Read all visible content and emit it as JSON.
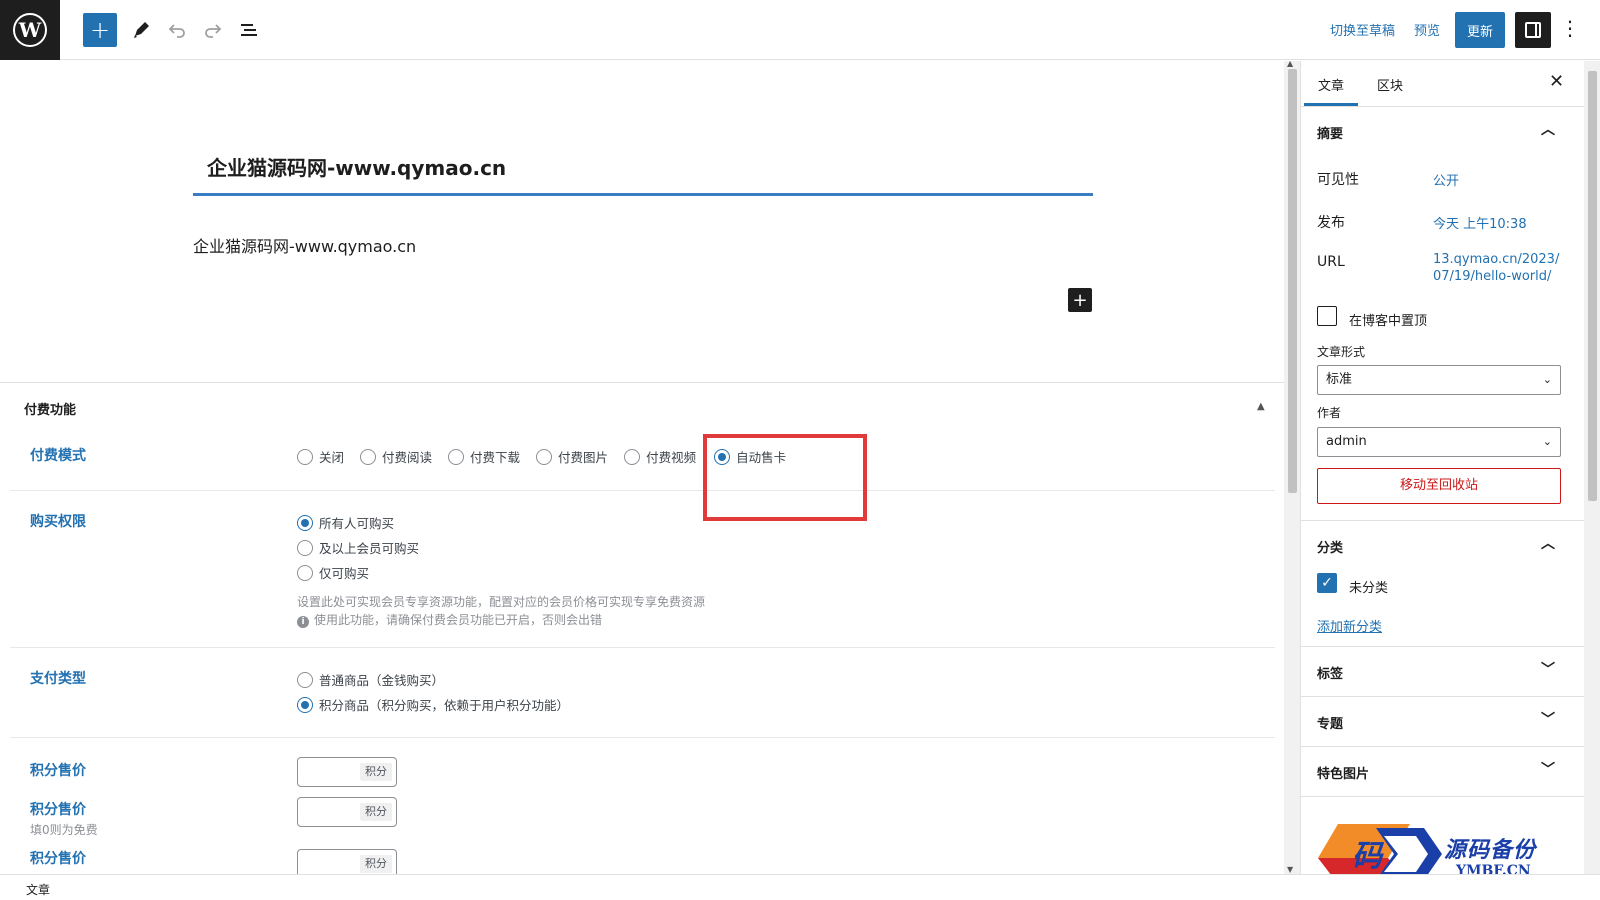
{
  "toolbar": {
    "add_icon": "plus-icon",
    "tools_icon": "pencil-icon",
    "undo_icon": "undo-icon",
    "redo_icon": "redo-icon",
    "outline_icon": "list-view-icon",
    "switch_draft": "切换至草稿",
    "preview": "预览",
    "update": "更新",
    "settings_icon": "sidebar-toggle-icon",
    "more_icon": "more-vertical-icon"
  },
  "post": {
    "title": "企业猫源码网-www.qymao.cn",
    "paragraph": "企业猫源码网-www.qymao.cn"
  },
  "metabox": {
    "title": "付费功能",
    "pay_mode": {
      "label": "付费模式",
      "options": [
        "关闭",
        "付费阅读",
        "付费下载",
        "付费图片",
        "付费视频",
        "自动售卡"
      ],
      "selected": "自动售卡"
    },
    "purchase_permission": {
      "label": "购买权限",
      "options": [
        "所有人可购买",
        "及以上会员可购买",
        "仅可购买"
      ],
      "selected": "所有人可购买",
      "hint1": "设置此处可实现会员专享资源功能，配置对应的会员价格可实现专享免费资源",
      "hint2": "使用此功能，请确保付费会员功能已开启，否则会出错"
    },
    "payment_type": {
      "label": "支付类型",
      "options": [
        "普通商品（金钱购买）",
        "积分商品（积分购买，依赖于用户积分功能）"
      ],
      "selected": "积分商品（积分购买，依赖于用户积分功能）"
    },
    "points_price_1": {
      "label": "积分售价",
      "unit": "积分"
    },
    "points_price_2": {
      "label": "积分售价",
      "sublabel": "填0则为免费",
      "unit": "积分"
    },
    "points_price_3": {
      "label": "积分售价",
      "unit": "积分"
    }
  },
  "sidebar": {
    "tabs": [
      "文章",
      "区块"
    ],
    "active_tab": "文章",
    "summary": {
      "title": "摘要",
      "visibility_label": "可见性",
      "visibility_value": "公开",
      "publish_label": "发布",
      "publish_value": "今天 上午10:38",
      "url_label": "URL",
      "url_line1": "13.qymao.cn/2023/",
      "url_line2": "07/19/hello-world/",
      "sticky_label": "在博客中置顶",
      "format_label": "文章形式",
      "format_value": "标准",
      "author_label": "作者",
      "author_value": "admin",
      "trash": "移动至回收站"
    },
    "categories": {
      "title": "分类",
      "item": "未分类",
      "add_new": "添加新分类"
    },
    "tags": {
      "title": "标签"
    },
    "topics": {
      "title": "专题"
    },
    "featured_image": {
      "title": "特色图片"
    }
  },
  "watermark": {
    "glyph": "码",
    "text": "源码备份",
    "sub": "YMBF.CN"
  },
  "footer": {
    "breadcrumb": "文章"
  },
  "colors": {
    "accent": "#2271b1",
    "highlight": "#e03a3a",
    "trash": "#cc1818"
  }
}
